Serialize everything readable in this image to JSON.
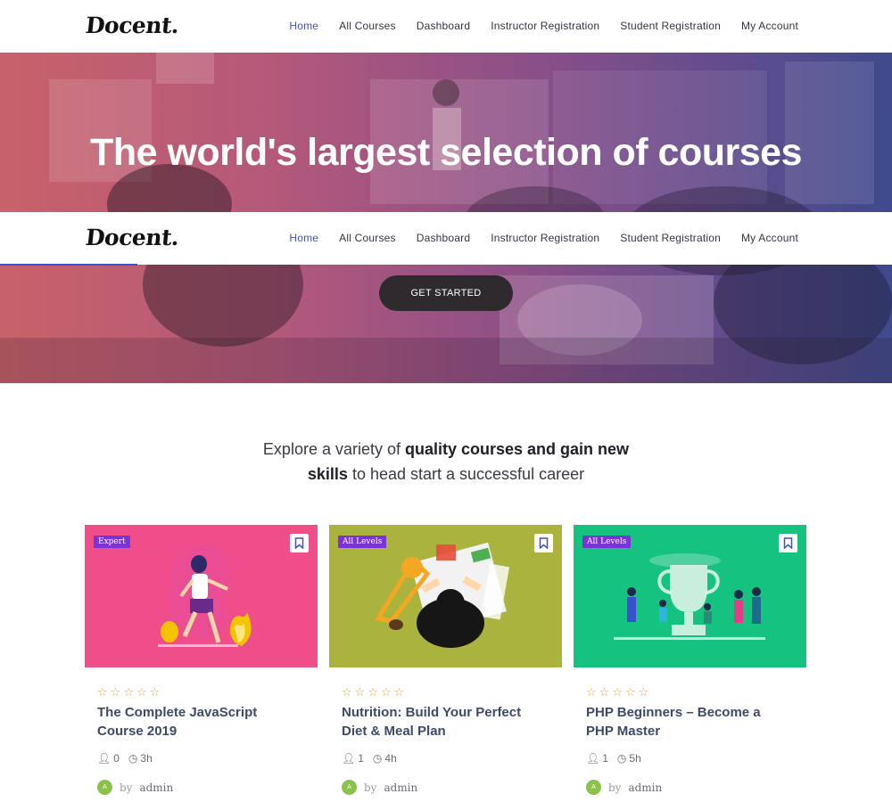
{
  "brand": {
    "logo": "Docent."
  },
  "nav": [
    {
      "label": "Home",
      "active": true
    },
    {
      "label": "All Courses"
    },
    {
      "label": "Dashboard"
    },
    {
      "label": "Instructor Registration"
    },
    {
      "label": "Student Registration"
    },
    {
      "label": "My Account"
    }
  ],
  "hero": {
    "title": "The world's largest selection of courses",
    "cta": "GET STARTED"
  },
  "intro": {
    "part1": "Explore a variety of ",
    "bold1": "quality courses and gain new",
    "bold2": "skills",
    "part2": " to head start a successful career"
  },
  "colors": {
    "accent": "#3f51c9",
    "badge": "#7b32d6",
    "star": "#e2a53a"
  },
  "courses": [
    {
      "level": "Expert",
      "title": "The Complete JavaScript Course 2019",
      "students": "0",
      "duration": "3h",
      "author_initial": "A",
      "by": "by",
      "author": "admin",
      "thumb_color": "#f04e8a"
    },
    {
      "level": "All Levels",
      "title": "Nutrition: Build Your Perfect Diet & Meal Plan",
      "students": "1",
      "duration": "4h",
      "author_initial": "A",
      "by": "by",
      "author": "admin",
      "thumb_color": "#abb33f"
    },
    {
      "level": "All Levels",
      "title": "PHP Beginners – Become a PHP Master",
      "students": "1",
      "duration": "5h",
      "author_initial": "A",
      "by": "by",
      "author": "admin",
      "thumb_color": "#15c27f"
    }
  ]
}
